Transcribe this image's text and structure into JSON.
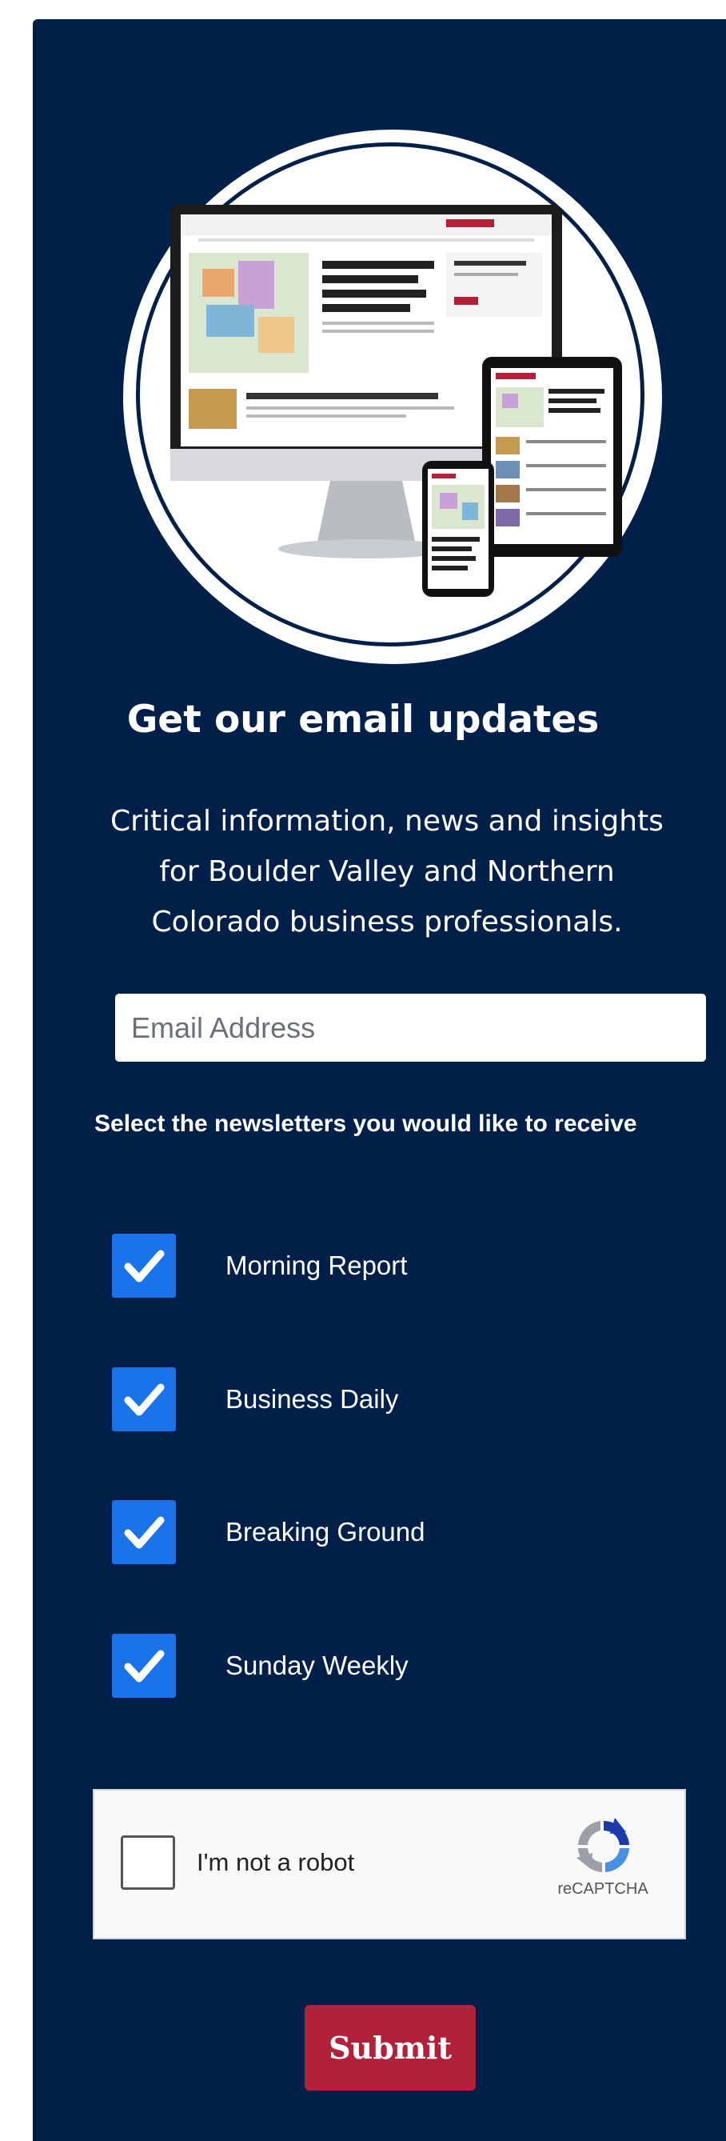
{
  "signup": {
    "heading": "Get our email updates",
    "intro": "Critical information, news and insights for Boulder Valley and Northern Colorado business professionals.",
    "email_placeholder": "Email Address",
    "email_value": "",
    "newsletters_prompt": "Select the newsletters you would like to receive",
    "newsletters": [
      {
        "label": "Morning Report",
        "checked": true
      },
      {
        "label": "Business Daily",
        "checked": true
      },
      {
        "label": "Breaking Ground",
        "checked": true
      },
      {
        "label": "Sunday Weekly",
        "checked": true
      }
    ],
    "recaptcha": {
      "label": "I'm not a robot",
      "brand": "reCAPTCHA",
      "checked": false
    },
    "submit_label": "Submit"
  },
  "colors": {
    "panel_bg": "#00204a",
    "checkbox_blue": "#1a73e8",
    "submit_red": "#b3203a"
  },
  "icons": {
    "hero": "devices-illustration-icon",
    "check": "checkmark-icon",
    "recaptcha": "recaptcha-logo-icon"
  }
}
